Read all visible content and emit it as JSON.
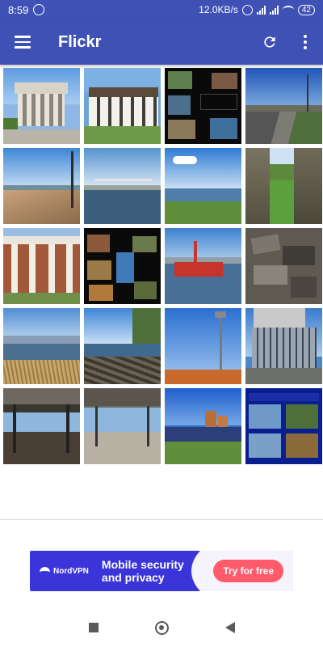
{
  "status_bar": {
    "time": "8:59",
    "net_speed": "12.0KB/s",
    "battery": "42"
  },
  "app_bar": {
    "title": "Flickr",
    "menu_icon": "hamburger-menu-icon",
    "refresh_icon": "refresh-icon",
    "overflow_icon": "more-vert-icon"
  },
  "photos": [
    {
      "name": "photo-greek-revival-building"
    },
    {
      "name": "photo-white-house-lawn"
    },
    {
      "name": "photo-homes-collage"
    },
    {
      "name": "photo-waterfront-path"
    },
    {
      "name": "photo-boardwalk-pier"
    },
    {
      "name": "photo-bridge-over-water"
    },
    {
      "name": "photo-harbor-view"
    },
    {
      "name": "photo-stone-walls-lawn"
    },
    {
      "name": "photo-columned-brick-house"
    },
    {
      "name": "photo-collage-dark"
    },
    {
      "name": "photo-red-tugboat"
    },
    {
      "name": "photo-rocks"
    },
    {
      "name": "photo-city-skyline-grass"
    },
    {
      "name": "photo-rocky-shore-trees"
    },
    {
      "name": "photo-stadium-lights"
    },
    {
      "name": "photo-stadium-seats"
    },
    {
      "name": "photo-stadium-grandstand"
    },
    {
      "name": "photo-stadium-shelter"
    },
    {
      "name": "photo-ballpark-field"
    },
    {
      "name": "photo-ballpark-collage"
    }
  ],
  "ad": {
    "brand": "NordVPN",
    "headline": "Mobile security and privacy",
    "cta": "Try for free"
  },
  "nav": {
    "recents_icon": "recents-square-icon",
    "home_icon": "home-circle-icon",
    "back_icon": "back-triangle-icon"
  }
}
